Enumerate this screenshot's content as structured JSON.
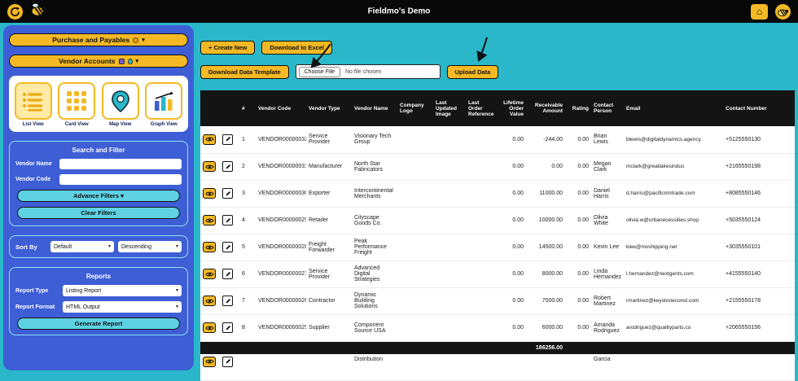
{
  "topbar": {
    "title": "Fieldmo's Demo"
  },
  "icons": {
    "caret": "▾",
    "home": "⌂"
  },
  "sidebar": {
    "purchase_menu": {
      "label": "Purchase and Payables"
    },
    "vendor_menu": {
      "label": "Vendor Accounts"
    },
    "views": [
      {
        "label": "List View"
      },
      {
        "label": "Card View"
      },
      {
        "label": "Map View"
      },
      {
        "label": "Graph View"
      }
    ],
    "search_filter": {
      "title": "Search and Filter",
      "fields": [
        {
          "label": "Vendor Name",
          "value": ""
        },
        {
          "label": "Vendor Code",
          "value": ""
        }
      ],
      "advance_filters": "Advance Filters ▾",
      "clear_filters": "Clear Filters",
      "sort_by_label": "Sort By",
      "sort_field": "Default",
      "sort_direction": "Descending"
    },
    "reports": {
      "title": "Reports",
      "type_label": "Report Type",
      "type_value": "Listing Report",
      "format_label": "Report Format",
      "format_value": "HTML Output",
      "generate": "Generate Report"
    }
  },
  "toolbar": {
    "create_new": "+ Create New",
    "download_excel": "Download to Excel",
    "download_template": "Download Data Template",
    "choose_file": "Choose File",
    "file_status": "No file chosen",
    "upload_data": "Upload Data"
  },
  "table": {
    "headers": [
      "#",
      "Vendor Code",
      "Vendor Type",
      "Vendor Name",
      "Company Logo",
      "Last Updated Image",
      "Last Order Reference",
      "Lifetime Order Value",
      "Receivable Amount",
      "Rating",
      "Contact Person",
      "Email",
      "Contact Number"
    ],
    "rows": [
      {
        "num": "1",
        "code": "VENDOR00000032",
        "type": "Service Provider",
        "name": "Visionary Tech Group",
        "logo": "",
        "image": "",
        "order_ref": "",
        "lifetime": "0.00",
        "receivable": "-244.00",
        "rating": "0.00",
        "contact": "Brian Lewis",
        "email": "blewis@digitaldynamics.agency",
        "phone": "+5125550130"
      },
      {
        "num": "2",
        "code": "VENDOR00000031",
        "type": "Manufacturer",
        "name": "North Star Fabricators",
        "logo": "",
        "image": "",
        "order_ref": "",
        "lifetime": "0.00",
        "receivable": "0.00",
        "rating": "0.00",
        "contact": "Megan Clark",
        "email": "mclark@greatlakesindus",
        "phone": "+2165550198"
      },
      {
        "num": "3",
        "code": "VENDOR00000030",
        "type": "Exporter",
        "name": "Intercontinental Merchants",
        "logo": "",
        "image": "",
        "order_ref": "",
        "lifetime": "0.00",
        "receivable": "11000.00",
        "rating": "0.00",
        "contact": "Daniel Harris",
        "email": "d.harris@pacificrimtrade.com",
        "phone": "+8085550146"
      },
      {
        "num": "4",
        "code": "VENDOR00000029",
        "type": "Retailer",
        "name": "Cityscape Goods Co.",
        "logo": "",
        "image": "",
        "order_ref": "",
        "lifetime": "0.00",
        "receivable": "10000.00",
        "rating": "0.00",
        "contact": "Olivia White",
        "email": "olivia.w@urbanecessities.shop",
        "phone": "+5035550124"
      },
      {
        "num": "5",
        "code": "VENDOR00000028",
        "type": "Freight Forwarder",
        "name": "Peak Performance Freight",
        "logo": "",
        "image": "",
        "order_ref": "",
        "lifetime": "0.00",
        "receivable": "14500.00",
        "rating": "0.00",
        "contact": "Kevin Lee",
        "email": "klee@mvshipping.net",
        "phone": "+3035550101"
      },
      {
        "num": "6",
        "code": "VENDOR00000027",
        "type": "Service Provider",
        "name": "Advanced Digital Strategies",
        "logo": "",
        "image": "",
        "order_ref": "",
        "lifetime": "0.00",
        "receivable": "8000.00",
        "rating": "0.00",
        "contact": "Linda Hernandez",
        "email": "l.hernandez@nextgents.com",
        "phone": "+4155550140"
      },
      {
        "num": "7",
        "code": "VENDOR00000026",
        "type": "Contractor",
        "name": "Dynamic Building Solutions",
        "logo": "",
        "image": "",
        "order_ref": "",
        "lifetime": "0.00",
        "receivable": "7000.00",
        "rating": "0.00",
        "contact": "Robert Martinez",
        "email": "rmartinez@keystoneconst.com",
        "phone": "+2155550178"
      },
      {
        "num": "8",
        "code": "VENDOR00000025",
        "type": "Supplier",
        "name": "Component Source USA",
        "logo": "",
        "image": "",
        "order_ref": "",
        "lifetime": "0.00",
        "receivable": "6000.00",
        "rating": "0.00",
        "contact": "Amanda Rodriguez",
        "email": "arodriguez@qualityparts.co",
        "phone": "+2065550156"
      }
    ],
    "total": "186256.00",
    "partial_row": {
      "num": "",
      "code": "",
      "type": "",
      "name": "Distribution",
      "logo": "",
      "image": "",
      "order_ref": "",
      "lifetime": "",
      "receivable": "",
      "rating": "",
      "contact": "Garcia",
      "email": "",
      "phone": ""
    }
  },
  "colors": {
    "accent_yellow": "#f4b925",
    "sidebar_blue": "#3e5ed6",
    "main_teal": "#2ab7c9",
    "button_cyan": "#5ed1e3"
  }
}
